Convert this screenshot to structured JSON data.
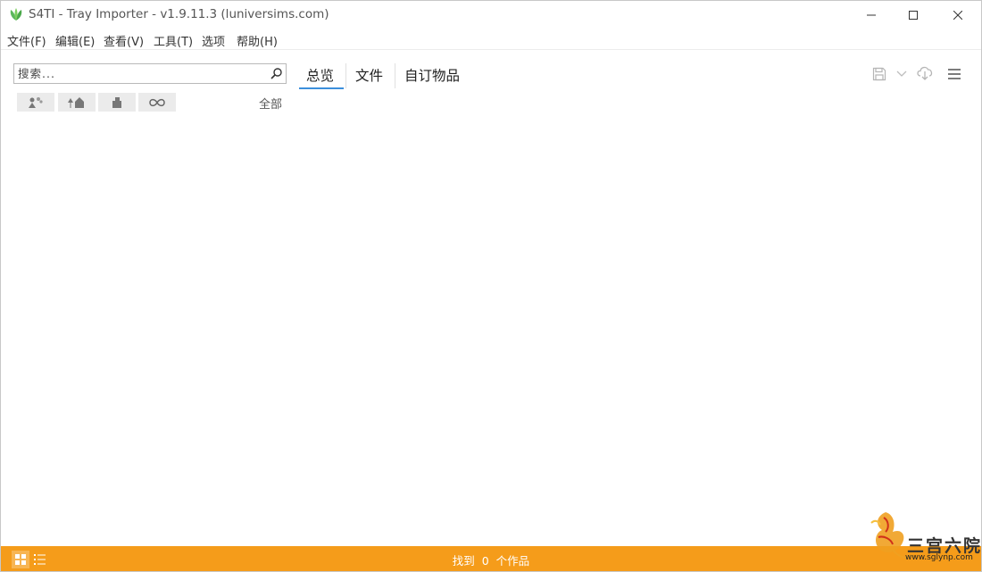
{
  "window": {
    "title": "S4TI - Tray Importer - v1.9.11.3  (luniversims.com)",
    "icon": "leaf-logo-icon",
    "controls": [
      "minimize-icon",
      "maximize-icon",
      "close-icon"
    ]
  },
  "menubar": {
    "items": [
      {
        "label": "文件(F)"
      },
      {
        "label": "编辑(E)"
      },
      {
        "label": "查看(V)"
      },
      {
        "label": "工具(T)"
      },
      {
        "label": "选项"
      },
      {
        "label": "帮助(H)"
      }
    ]
  },
  "search": {
    "placeholder": "搜索...",
    "value": ""
  },
  "filters": {
    "buttons": [
      "sims-icon",
      "lots-icon",
      "rooms-icon",
      "infinity-icon"
    ],
    "scope_label": "全部"
  },
  "tabs": [
    {
      "label": "总览",
      "active": true
    },
    {
      "label": "文件",
      "active": false
    },
    {
      "label": "自订物品",
      "active": false
    }
  ],
  "toolbar": {
    "icons": [
      "save-icon",
      "chevron-down-icon",
      "cloud-download-icon",
      "hamburger-menu-icon"
    ]
  },
  "statusbar": {
    "found_prefix": "找到",
    "count": "0",
    "found_suffix": "个作品",
    "background": "#f59c1a"
  },
  "watermark": {
    "text": "三宫六院",
    "url": "www.sglynp.com"
  },
  "colors": {
    "accent": "#3c8fdc",
    "status": "#f59c1a"
  }
}
